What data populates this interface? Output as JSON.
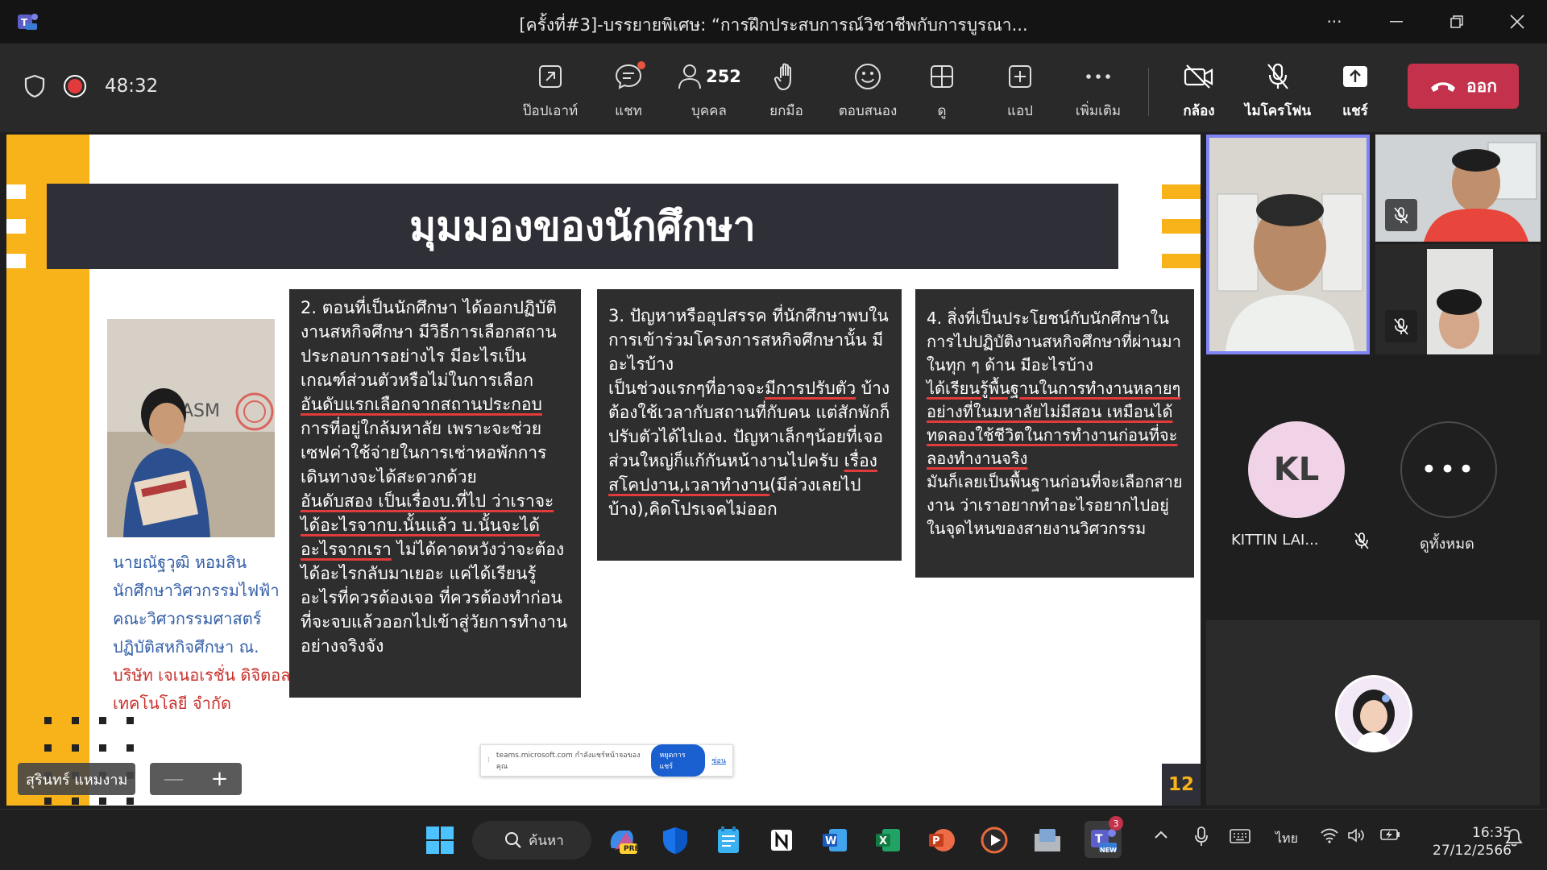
{
  "window": {
    "title": "[ครั้งที่#3]-บรรยายพิเศษ: “การฝึกประสบการณ์วิชาชีพกับการบูรณา...",
    "more_label": "···"
  },
  "toolbar": {
    "timer": "48:32",
    "popout_label": "ป๊อปเอาท์",
    "chat_label": "แชท",
    "people_count": "252",
    "people_label": "บุคคล",
    "raise_label": "ยกมือ",
    "react_label": "ตอบสนอง",
    "view_label": "ดู",
    "apps_label": "แอป",
    "more_label": "เพิ่มเติม",
    "camera_label": "กล้อง",
    "mic_label": "ไมโครโฟน",
    "share_label": "แชร์",
    "leave_label": "ออก"
  },
  "slide": {
    "title": "มุมมองของนักศึกษา",
    "caption": {
      "line1": "นายณัฐวุฒิ หอมสิน",
      "line2": "นักศึกษาวิศวกรรมไฟฟ้า",
      "line3": "คณะวิศวกรรมศาสตร์",
      "line4": "ปฏิบัติสหกิจศึกษา ณ.",
      "line5": "บริษัท เจเนอเรชั่น ดิจิตอล",
      "line6": "เทคโนโลยี จำกัด"
    },
    "box2": {
      "p1": "2. ตอนที่เป็นนักศึกษา ได้ออกปฏิบัติงานสหกิจศึกษา มีวิธีการเลือกสถานประกอบการอย่างไร มีอะไรเป็นเกณฑ์ส่วนตัวหรือไม่ในการเลือก",
      "u1": "อันดับแรกเลือกจากสถานประกอบ",
      "p2": "การที่อยู่ใกล้มหาลัย เพราะจะช่วยเซฟค่าใช้จ่ายในการเช่าหอพักการเดินทางจะได้สะดวกด้วย",
      "u2": "อันดับสอง เป็นเรื่องบ.ที่ไป ว่าเราจะได้อะไรจากบ.นั้นแล้ว บ.นั้นจะได้อะไรจากเรา",
      "p3": " ไม่ได้คาดหวังว่าจะต้องได้อะไรกลับมาเยอะ แค่ได้เรียนรู้อะไรที่ควรต้องเจอ ที่ควรต้องทำก่อนที่จะจบแล้วออกไปเข้าสู่วัยการทำงานอย่างจริงจัง"
    },
    "box3": {
      "p1": "3. ปัญหาหรืออุปสรรค ที่นักศึกษาพบในการเข้าร่วมโครงการสหกิจศึกษานั้น มีอะไรบ้าง",
      "p2": "เป็นช่วงแรกๆที่อาจจะ",
      "u1": "มีการปรับตัว",
      "p3": "บ้าง ต้องใช้เวลากับสถานที่กับคน แต่สักพักก็ปรับตัวได้ไปเอง. ปัญหาเล็กๆน้อยที่เจอส่วนใหญ่ก็แก้กันหน้างานไปครับ ",
      "u2": "เรื่อง สโคปงาน,เวลาทำงาน",
      "p4": "(มีล่วงเลยไปบ้าง),คิดโปรเจคไม่ออก"
    },
    "box4": {
      "p1": "4. สิ่งที่เป็นประโยชน์กับนักศึกษาในการไปปฏิบัติงานสหกิจศึกษาที่ผ่านมาในทุก ๆ ด้าน มีอะไรบ้าง",
      "u1": "ได้เรียนรู้พื้นฐานในการทำงานหลายๆอย่างที่ในมหาลัยไม่มีสอน เหมือนได้ทดลองใช้ชีวิตในการทำงานก่อนที่จะลองทำงานจริง",
      "p2": "มันก็เลยเป็นพื้นฐานก่อนที่จะเลือกสายงาน ว่าเราอยากทำอะไรอยากไปอยู่ในจุดไหนของสายงานวิศวกรรม"
    },
    "photo_sign": "ASM",
    "page_number": "12"
  },
  "share_notice": {
    "text": "teams.microsoft.com กำลังแชร์หน้าจอของคุณ",
    "stop_label": "หยุดการแชร์",
    "hide_label": "ซ่อน"
  },
  "presenter": {
    "name": "สุรินทร์ แหมงาม",
    "zoom_minus": "—",
    "zoom_plus": "+"
  },
  "participants": {
    "kl_initials": "KL",
    "kl_name": "KITTIN LAI...",
    "view_all_label": "ดูทั้งหมด",
    "more_dots": "•••"
  },
  "taskbar": {
    "search_label": "ค้นหา",
    "copilot_badge": "PRE",
    "teams_badge": "3",
    "teams_new": "NEW",
    "lang": "ไทย",
    "time": "16:35",
    "date": "27/12/2566"
  },
  "colors": {
    "accent_purple": "#7f85f5",
    "leave_red": "#c4314b",
    "slide_yellow": "#f8b21a",
    "slide_dark": "#2f2f37"
  }
}
